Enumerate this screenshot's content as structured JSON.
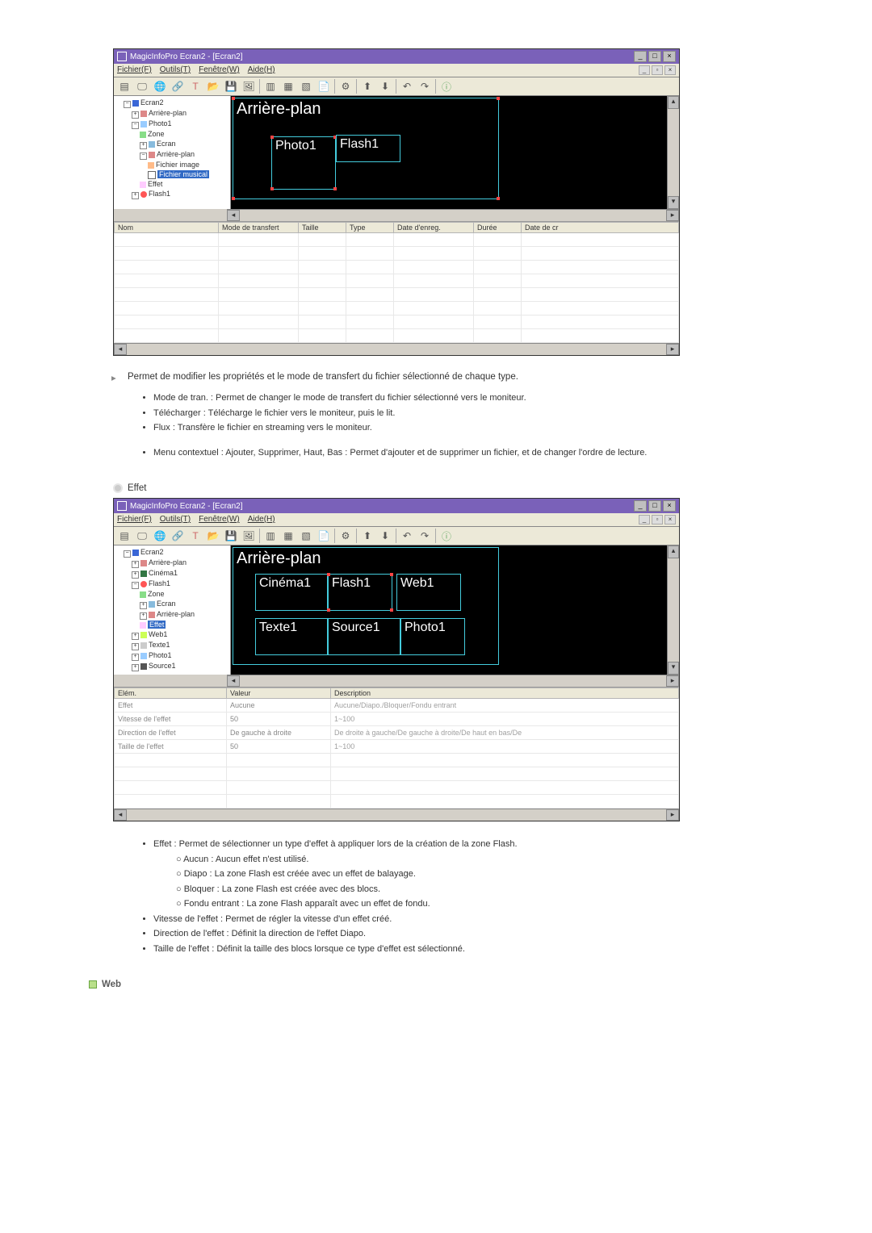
{
  "app1": {
    "title": "MagicInfoPro Ecran2 - [Ecran2]",
    "menu": [
      "Fichier(F)",
      "Outils(T)",
      "Fenêtre(W)",
      "Aide(H)"
    ],
    "tree": [
      "Ecran2",
      "Arrière-plan",
      "Photo1",
      "Zone",
      "Ecran",
      "Arrière-plan",
      "Fichier image",
      "Fichier musical",
      "Effet",
      "Flash1"
    ],
    "regions": {
      "bg": "Arrière-plan",
      "photo": "Photo1",
      "flash": "Flash1"
    },
    "table_headers": [
      "Nom",
      "Mode de transfert",
      "Taille",
      "Type",
      "Date d'enreg.",
      "Durée",
      "Date de cr"
    ]
  },
  "prose1": {
    "lead": "Permet de modifier les propriétés et le mode de transfert du fichier sélectionné de chaque type.",
    "bullets_a": [
      "Mode de tran. : Permet de changer le mode de transfert du fichier sélectionné vers le moniteur.",
      "Télécharger : Télécharge le fichier vers le moniteur, puis le lit.",
      "Flux : Transfère le fichier en streaming vers le moniteur."
    ],
    "bullets_b": [
      "Menu contextuel : Ajouter, Supprimer, Haut, Bas : Permet d'ajouter et de supprimer un fichier, et de changer l'ordre de lecture."
    ]
  },
  "section_effet": "Effet",
  "app2": {
    "title": "MagicInfoPro Ecran2 - [Ecran2]",
    "menu": [
      "Fichier(F)",
      "Outils(T)",
      "Fenêtre(W)",
      "Aide(H)"
    ],
    "tree": [
      "Ecran2",
      "Arrière-plan",
      "Cinéma1",
      "Flash1",
      "Zone",
      "Ecran",
      "Arrière-plan",
      "Effet",
      "Web1",
      "Texte1",
      "Photo1",
      "Source1"
    ],
    "regions": {
      "bg": "Arrière-plan",
      "cinema": "Cinéma1",
      "flash": "Flash1",
      "web": "Web1",
      "texte": "Texte1",
      "source": "Source1",
      "photo": "Photo1"
    },
    "table_headers": [
      "Elém.",
      "Valeur",
      "Description"
    ],
    "rows": [
      {
        "e": "Effet",
        "v": "Aucune",
        "d": "Aucune/Diapo./Bloquer/Fondu entrant"
      },
      {
        "e": "Vitesse de l'effet",
        "v": "50",
        "d": "1~100"
      },
      {
        "e": "Direction de l'effet",
        "v": "De gauche à droite",
        "d": "De droite à gauche/De gauche à droite/De haut en bas/De"
      },
      {
        "e": "Taille de l'effet",
        "v": "50",
        "d": "1~100"
      }
    ]
  },
  "prose2": {
    "bullets": [
      "Effet : Permet de sélectionner un type d'effet à appliquer lors de la création de la zone Flash.",
      "Vitesse de l'effet : Permet de régler la vitesse d'un effet créé.",
      "Direction de l'effet : Définit la direction de l'effet Diapo.",
      "Taille de l'effet : Définit la taille des blocs lorsque ce type d'effet est sélectionné."
    ],
    "sub": [
      "Aucun : Aucun effet n'est utilisé.",
      "Diapo : La zone Flash est créée avec un effet de balayage.",
      "Bloquer : La zone Flash est créée avec des blocs.",
      "Fondu entrant : La zone Flash apparaît avec un effet de fondu."
    ]
  },
  "web_heading": "Web"
}
